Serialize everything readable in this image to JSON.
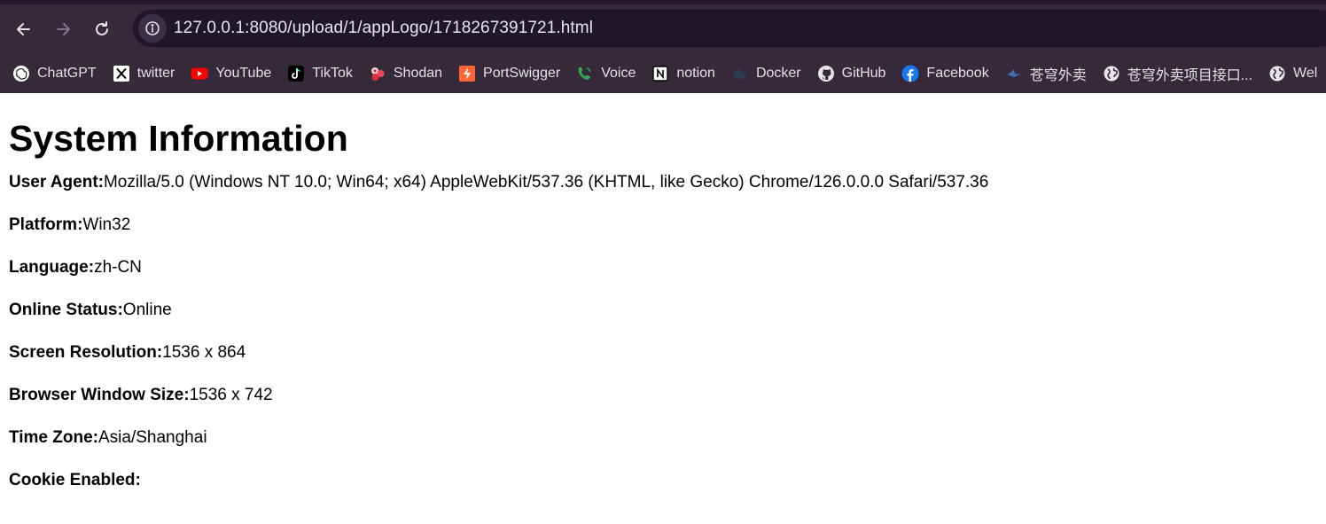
{
  "browser": {
    "url": "127.0.0.1:8080/upload/1/appLogo/1718267391721.html",
    "bookmarks": [
      {
        "label": "ChatGPT",
        "icon": "chatgpt-icon"
      },
      {
        "label": "twitter",
        "icon": "x-icon"
      },
      {
        "label": "YouTube",
        "icon": "youtube-icon"
      },
      {
        "label": "TikTok",
        "icon": "tiktok-icon"
      },
      {
        "label": "Shodan",
        "icon": "shodan-icon"
      },
      {
        "label": "PortSwigger",
        "icon": "portswigger-icon"
      },
      {
        "label": "Voice",
        "icon": "phone-icon"
      },
      {
        "label": "notion",
        "icon": "notion-icon"
      },
      {
        "label": "Docker",
        "icon": "docker-icon"
      },
      {
        "label": "GitHub",
        "icon": "github-icon"
      },
      {
        "label": "Facebook",
        "icon": "facebook-icon"
      },
      {
        "label": "苍穹外卖",
        "icon": "bird-icon"
      },
      {
        "label": "苍穹外卖项目接口...",
        "icon": "globe-icon"
      },
      {
        "label": "Wel",
        "icon": "globe-icon"
      }
    ]
  },
  "page": {
    "title": "System Information",
    "rows": [
      {
        "label": "User Agent:",
        "value": "Mozilla/5.0 (Windows NT 10.0; Win64; x64) AppleWebKit/537.36 (KHTML, like Gecko) Chrome/126.0.0.0 Safari/537.36"
      },
      {
        "label": "Platform:",
        "value": "Win32"
      },
      {
        "label": "Language:",
        "value": "zh-CN"
      },
      {
        "label": "Online Status:",
        "value": "Online"
      },
      {
        "label": "Screen Resolution:",
        "value": "1536 x 864"
      },
      {
        "label": "Browser Window Size:",
        "value": "1536 x 742"
      },
      {
        "label": "Time Zone:",
        "value": "Asia/Shanghai"
      },
      {
        "label": "Cookie Enabled:",
        "value": ""
      }
    ]
  }
}
